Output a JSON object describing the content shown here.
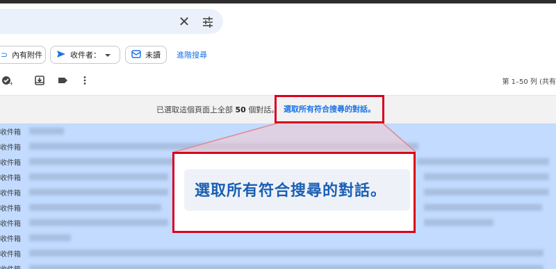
{
  "search": {
    "clear_icon": "close-icon",
    "options_icon": "tune-icon"
  },
  "filters": {
    "has_attachment": "內有附件",
    "recipient": "收件者：",
    "unread": "未讀",
    "advanced_search": "進階搜尋"
  },
  "toolbar": {
    "page_count": "第 1–50 列 (共有"
  },
  "banner": {
    "prefix": "已選取這個頁面上全部",
    "count": "50",
    "suffix": "個對話。",
    "select_all_link": "選取所有符合搜尋的對話。"
  },
  "list": {
    "rows": [
      {
        "label": "收件箱"
      },
      {
        "label": "收件箱"
      },
      {
        "label": "收件箱"
      },
      {
        "label": "收件箱"
      },
      {
        "label": "收件箱"
      },
      {
        "label": "收件箱"
      },
      {
        "label": "收件箱"
      },
      {
        "label": "收件箱"
      },
      {
        "label": "收件箱"
      },
      {
        "label": "收件箱"
      }
    ]
  },
  "callout": {
    "zoomed_text": "選取所有符合搜尋的對話。"
  },
  "colors": {
    "accent": "#1a73e8",
    "highlight_border": "#d9001b",
    "selected_row": "#c2dbff"
  }
}
